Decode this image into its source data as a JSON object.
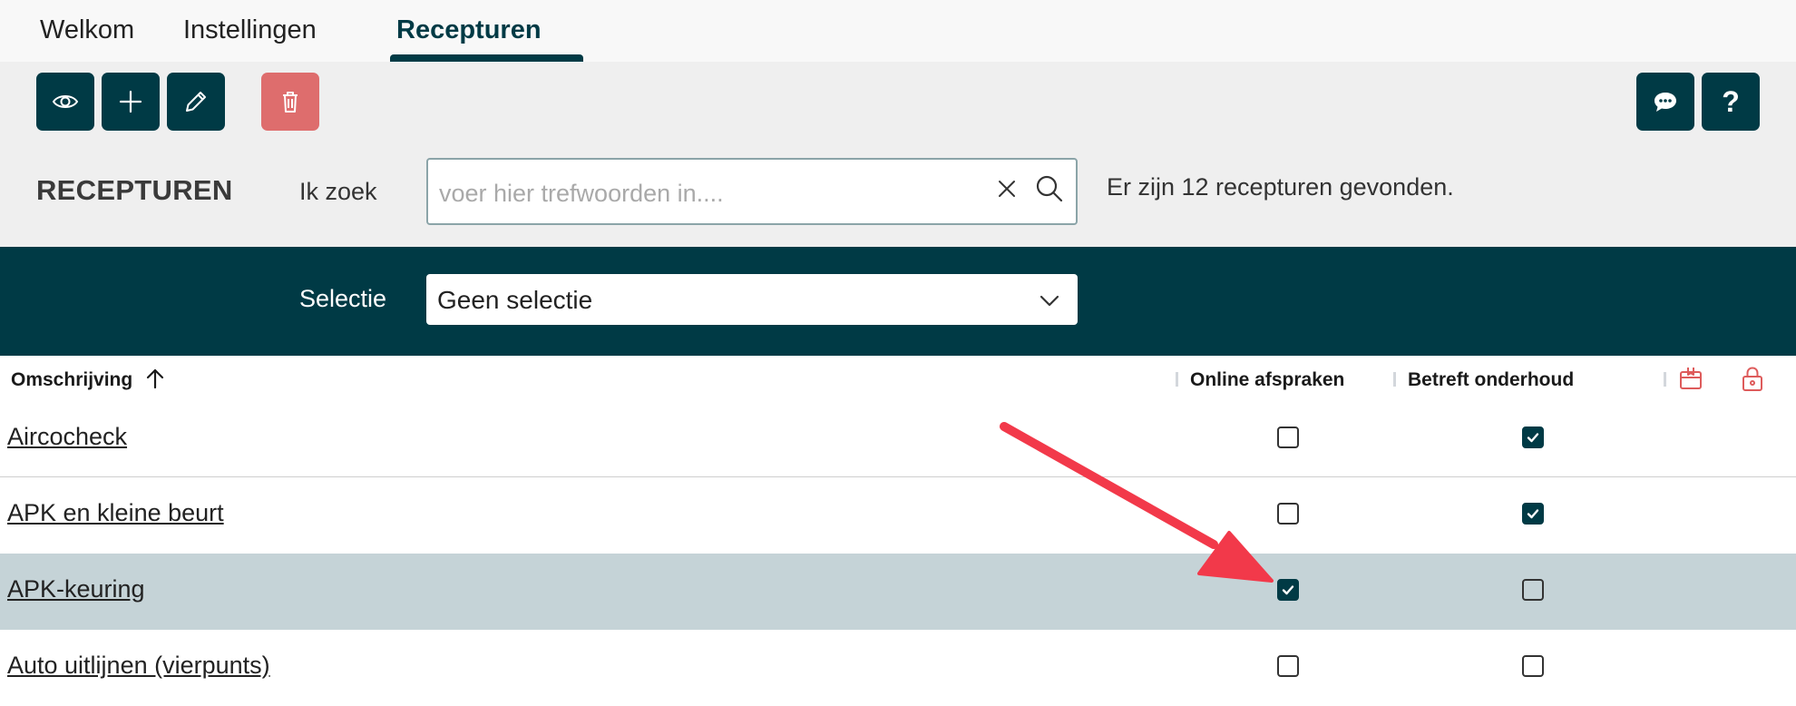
{
  "tabs": [
    {
      "label": "Welkom",
      "active": false
    },
    {
      "label": "Instellingen",
      "active": false
    },
    {
      "label": "Recepturen",
      "active": true
    }
  ],
  "toolbar": {
    "buttons": [
      {
        "icon": "eye-icon",
        "action": "view"
      },
      {
        "icon": "plus-icon",
        "action": "add"
      },
      {
        "icon": "pencil-icon",
        "action": "edit"
      },
      {
        "icon": "trash-icon",
        "action": "delete"
      }
    ],
    "right_buttons": [
      {
        "icon": "chat-icon",
        "action": "chat"
      },
      {
        "icon": "help-icon",
        "label": "?",
        "action": "help"
      }
    ]
  },
  "page": {
    "title": "RECEPTUREN",
    "search_label": "Ik zoek",
    "search_placeholder": "voer hier trefwoorden in....",
    "search_value": "",
    "result_count_text": "Er zijn 12 recepturen gevonden."
  },
  "selection": {
    "label": "Selectie",
    "value": "Geen selectie"
  },
  "table": {
    "columns": [
      "Omschrijving",
      "Online afspraken",
      "Betreft onderhoud"
    ],
    "sort": "ascending",
    "rows": [
      {
        "name": "Aircocheck",
        "online_afspraken": false,
        "betreft_onderhoud": true
      },
      {
        "name": "APK en kleine beurt",
        "online_afspraken": false,
        "betreft_onderhoud": true
      },
      {
        "name": "APK-keuring",
        "online_afspraken": true,
        "betreft_onderhoud": false,
        "highlighted": true
      },
      {
        "name": "Auto uitlijnen (vierpunts)",
        "online_afspraken": false,
        "betreft_onderhoud": false
      }
    ]
  },
  "colors": {
    "primary": "#003a45",
    "danger": "#de6d6d",
    "highlight_row": "#c5d3d7",
    "annotation_arrow": "#f2394a"
  }
}
